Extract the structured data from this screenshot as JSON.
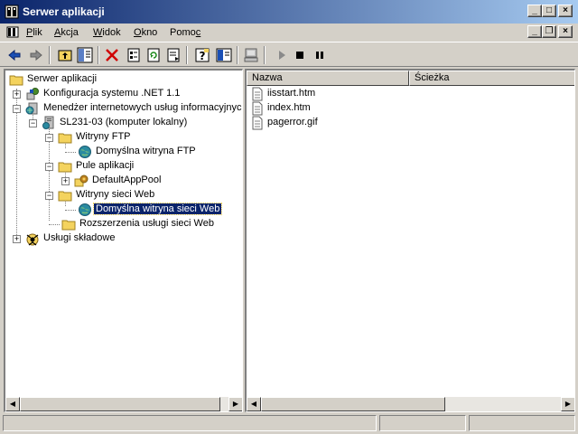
{
  "window": {
    "title": "Serwer aplikacji",
    "icon": "iis-app-icon",
    "accent_color": "#0a246a"
  },
  "caption_buttons": {
    "minimize": "_",
    "maximize": "□",
    "close": "×"
  },
  "menubar": {
    "items": [
      {
        "label": "Plik",
        "hotkey": "P"
      },
      {
        "label": "Akcja",
        "hotkey": "A"
      },
      {
        "label": "Widok",
        "hotkey": "W"
      },
      {
        "label": "Okno",
        "hotkey": "O"
      },
      {
        "label": "Pomoc",
        "hotkey": "c"
      }
    ],
    "mdi_buttons": {
      "minimize": "_",
      "restore": "❐",
      "close": "×"
    }
  },
  "toolbar": {
    "buttons": [
      "back-arrow-icon",
      "forward-arrow-icon",
      "up-level-icon",
      "show-tree-icon",
      "delete-icon",
      "properties-icon",
      "refresh-icon",
      "export-list-icon",
      "help-icon",
      "console-tree-icon",
      "computer-icon",
      "start-icon",
      "stop-icon",
      "pause-icon"
    ]
  },
  "tree": {
    "root": "Serwer aplikacji",
    "items": [
      {
        "label": "Konfiguracja systemu .NET 1.1"
      },
      {
        "label": "Menedżer internetowych usług informacyjnych"
      },
      {
        "label": "SL231-03 (komputer lokalny)"
      },
      {
        "label": "Witryny FTP"
      },
      {
        "label": "Domyślna witryna FTP"
      },
      {
        "label": "Pule aplikacji"
      },
      {
        "label": "DefaultAppPool"
      },
      {
        "label": "Witryny sieci Web"
      },
      {
        "label": "Domyślna witryna sieci Web",
        "selected": true
      },
      {
        "label": "Rozszerzenia usługi sieci Web"
      },
      {
        "label": "Usługi składowe"
      }
    ]
  },
  "list": {
    "columns": [
      "Nazwa",
      "Ścieżka"
    ],
    "rows": [
      {
        "name": "iisstart.htm",
        "path": ""
      },
      {
        "name": "index.htm",
        "path": ""
      },
      {
        "name": "pagerror.gif",
        "path": ""
      }
    ]
  },
  "statusbar": {
    "panels": [
      "",
      "",
      ""
    ]
  }
}
